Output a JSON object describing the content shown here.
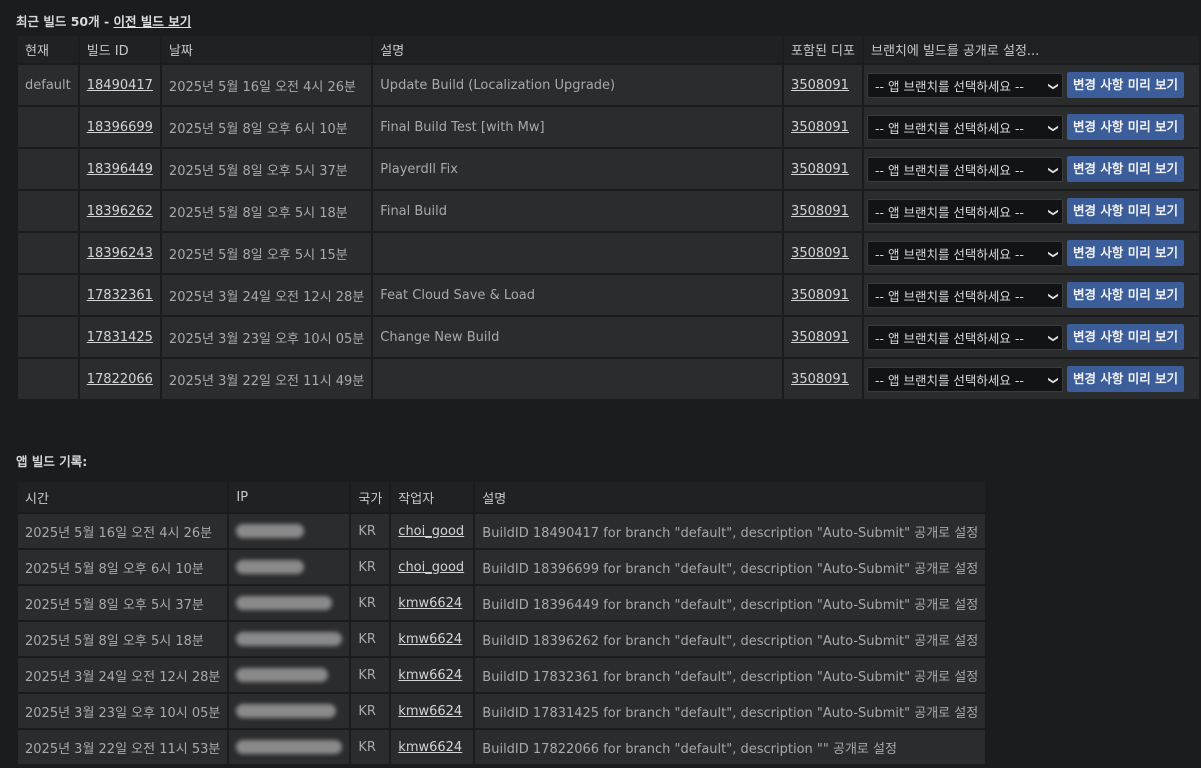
{
  "builds_section": {
    "title": "최근 빌드 50개 - ",
    "link": "이전 빌드 보기",
    "headers": [
      "현재",
      "빌드 ID",
      "날짜",
      "설명",
      "포함된 디포",
      "브랜치에 빌드를 공개로 설정..."
    ],
    "select_placeholder": "-- 앱 브랜치를 선택하세요 --",
    "preview_label": "변경 사항 미리 보기",
    "rows": [
      {
        "current": "default",
        "id": "18490417",
        "date": "2025년 5월 16일 오전 4시 26분",
        "desc": "Update Build (Localization Upgrade)",
        "depot": "3508091"
      },
      {
        "current": "",
        "id": "18396699",
        "date": "2025년 5월 8일 오후 6시 10분",
        "desc": "Final Build Test [with Mw]",
        "depot": "3508091"
      },
      {
        "current": "",
        "id": "18396449",
        "date": "2025년 5월 8일 오후 5시 37분",
        "desc": "Playerdll Fix",
        "depot": "3508091"
      },
      {
        "current": "",
        "id": "18396262",
        "date": "2025년 5월 8일 오후 5시 18분",
        "desc": "Final Build",
        "depot": "3508091"
      },
      {
        "current": "",
        "id": "18396243",
        "date": "2025년 5월 8일 오후 5시 15분",
        "desc": "",
        "depot": "3508091"
      },
      {
        "current": "",
        "id": "17832361",
        "date": "2025년 3월 24일 오전 12시 28분",
        "desc": "Feat Cloud Save & Load",
        "depot": "3508091"
      },
      {
        "current": "",
        "id": "17831425",
        "date": "2025년 3월 23일 오후 10시 05분",
        "desc": "Change New Build",
        "depot": "3508091"
      },
      {
        "current": "",
        "id": "17822066",
        "date": "2025년 3월 22일 오전 11시 49분",
        "desc": "",
        "depot": "3508091"
      }
    ]
  },
  "history_section": {
    "title": "앱 빌드 기록:",
    "headers": [
      "시간",
      "IP",
      "국가",
      "작업자",
      "설명"
    ],
    "rows": [
      {
        "time": "2025년 5월 16일 오전 4시 26분",
        "country": "KR",
        "user": "choi_good",
        "desc": "BuildID 18490417 for branch \"default\", description \"Auto-Submit\" 공개로 설정"
      },
      {
        "time": "2025년 5월 8일 오후 6시 10분",
        "country": "KR",
        "user": "choi_good",
        "desc": "BuildID 18396699 for branch \"default\", description \"Auto-Submit\" 공개로 설정"
      },
      {
        "time": "2025년 5월 8일 오후 5시 37분",
        "country": "KR",
        "user": "kmw6624",
        "desc": "BuildID 18396449 for branch \"default\", description \"Auto-Submit\" 공개로 설정"
      },
      {
        "time": "2025년 5월 8일 오후 5시 18분",
        "country": "KR",
        "user": "kmw6624",
        "desc": "BuildID 18396262 for branch \"default\", description \"Auto-Submit\" 공개로 설정"
      },
      {
        "time": "2025년 3월 24일 오전 12시 28분",
        "country": "KR",
        "user": "kmw6624",
        "desc": "BuildID 17832361 for branch \"default\", description \"Auto-Submit\" 공개로 설정"
      },
      {
        "time": "2025년 3월 23일 오후 10시 05분",
        "country": "KR",
        "user": "kmw6624",
        "desc": "BuildID 17831425 for branch \"default\", description \"Auto-Submit\" 공개로 설정"
      },
      {
        "time": "2025년 3월 22일 오전 11시 53분",
        "country": "KR",
        "user": "kmw6624",
        "desc": "BuildID 17822066 for branch \"default\", description \"\" 공개로 설정"
      }
    ]
  },
  "colors": {
    "background": "#1b1c1e",
    "cell": "#2b2c2e",
    "button": "#3b5d9a"
  }
}
